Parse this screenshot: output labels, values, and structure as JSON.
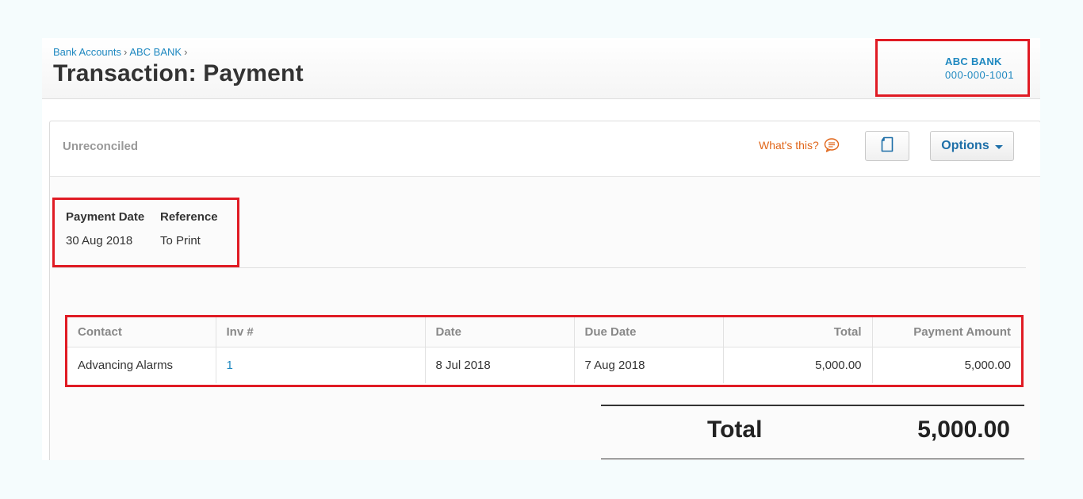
{
  "breadcrumb": {
    "items": [
      "Bank Accounts",
      "ABC BANK"
    ],
    "separator": "›"
  },
  "page_title": "Transaction: Payment",
  "account": {
    "name": "ABC BANK",
    "number": "000-000-1001"
  },
  "panel": {
    "status": "Unreconciled",
    "whats_this": "What's this?",
    "options_label": "Options"
  },
  "details": {
    "payment_date_label": "Payment Date",
    "payment_date_value": "30 Aug 2018",
    "reference_label": "Reference",
    "reference_value": "To Print"
  },
  "table": {
    "columns": [
      "Contact",
      "Inv #",
      "Date",
      "Due Date",
      "Total",
      "Payment Amount"
    ],
    "rows": [
      {
        "contact": "Advancing Alarms",
        "inv": "1",
        "date": "8 Jul 2018",
        "due_date": "7 Aug 2018",
        "total": "5,000.00",
        "payment_amount": "5,000.00"
      }
    ]
  },
  "summary": {
    "total_label": "Total",
    "total_value": "5,000.00"
  },
  "colors": {
    "link": "#1e88c0",
    "highlight": "#e01b24",
    "whats_this": "#e0661a",
    "options_text": "#1e6fa8"
  },
  "icons": {
    "whats_this": "speech-bubble-icon",
    "doc_button": "document-icon",
    "options": "caret-down-icon"
  }
}
